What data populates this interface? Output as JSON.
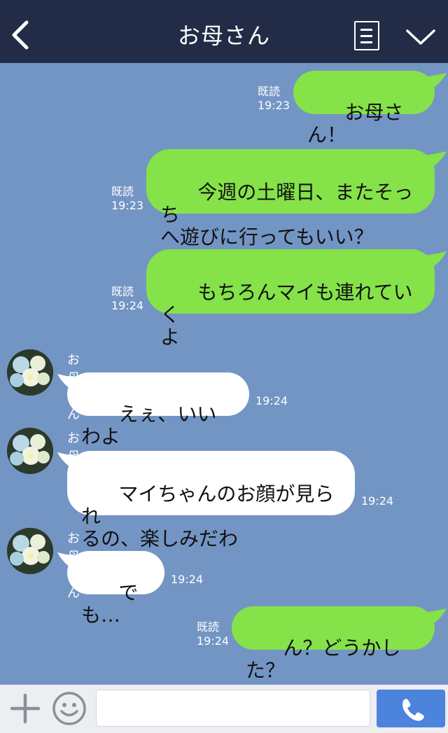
{
  "header": {
    "title": "お母さん",
    "back_icon": "chevron-left-icon",
    "menu_icon": "menu-list-icon",
    "collapse_icon": "chevron-down-icon"
  },
  "colors": {
    "header_bg": "#222c46",
    "chat_bg": "#7395c4",
    "my_bubble": "#85e249",
    "their_bubble": "#ffffff",
    "send_button": "#4b83dd"
  },
  "messages": [
    {
      "from": "me",
      "text": "お母さん！",
      "read": "既読",
      "time": "19:23"
    },
    {
      "from": "me",
      "text": "今週の土曜日、またそっち\nへ遊びに行ってもいい？",
      "read": "既読",
      "time": "19:23"
    },
    {
      "from": "me",
      "text": "もちろんマイも連れていく\nよ",
      "read": "既読",
      "time": "19:24"
    },
    {
      "from": "them",
      "sender": "お母さん",
      "text": "えぇ、いいわよ",
      "time": "19:24"
    },
    {
      "from": "them",
      "sender": "お母さん",
      "text": "マイちゃんのお顔が見られ\nるの、楽しみだわ",
      "time": "19:24"
    },
    {
      "from": "them",
      "sender": "お母さん",
      "text": "でも…",
      "time": "19:24"
    },
    {
      "from": "me",
      "text": "ん？どうかした？",
      "read": "既読",
      "time": "19:24"
    }
  ],
  "input": {
    "plus_icon": "plus-icon",
    "emoji_icon": "smiley-icon",
    "placeholder": "",
    "value": "",
    "call_icon": "phone-icon"
  }
}
